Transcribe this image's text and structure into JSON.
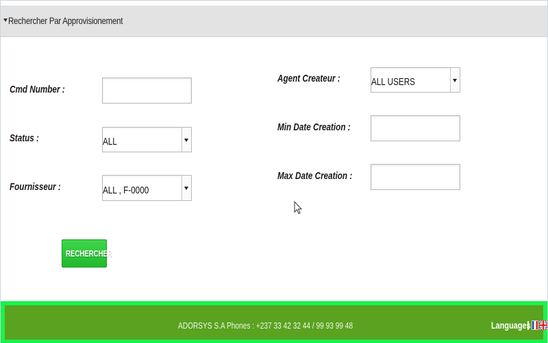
{
  "panel": {
    "title": "Rechercher Par Approvisionement"
  },
  "form": {
    "cmd_number": {
      "label": "Cmd Number :",
      "value": ""
    },
    "status": {
      "label": "Status :",
      "selected": "ALL"
    },
    "fournisseur": {
      "label": "Fournisseur :",
      "selected": "ALL , F-0000"
    },
    "agent_createur": {
      "label": "Agent Createur :",
      "selected": "ALL USERS"
    },
    "min_date_creation": {
      "label": "Min Date Creation :",
      "value": ""
    },
    "max_date_creation": {
      "label": "Max Date Creation :",
      "value": ""
    }
  },
  "search_button": {
    "label": "RECHERCHER"
  },
  "footer": {
    "company_text": "ADORSYS S.A Phones : +237 33 42 32 44 / 99 93 99 48",
    "languages_label": "Languages",
    "separator": "|",
    "flags": [
      "flag-fr-icon",
      "flag-uk-icon"
    ]
  },
  "colors": {
    "header_bg": "#e3e3e3",
    "button_green": "#2ec43a",
    "footer_bg": "#5aa220",
    "footer_border": "#19f24c"
  }
}
